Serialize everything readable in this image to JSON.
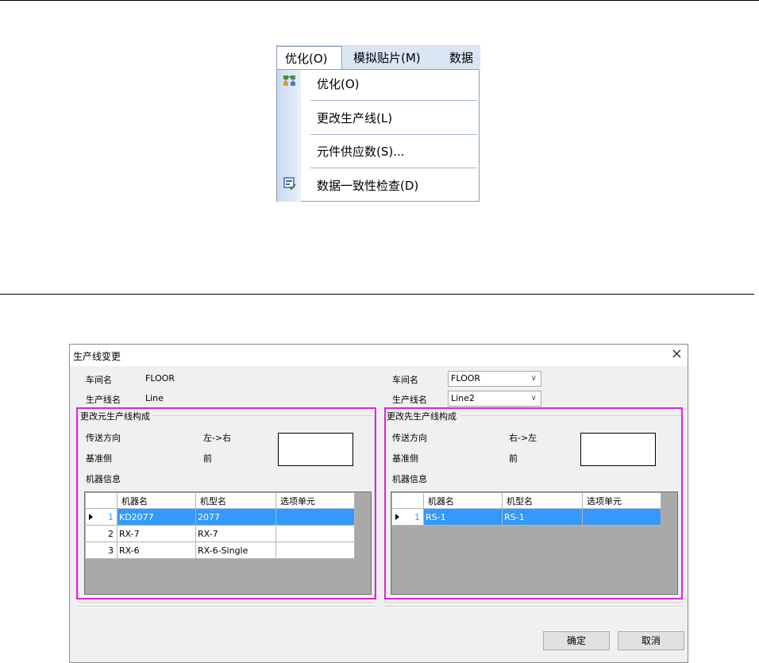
{
  "menu": {
    "bar": [
      "优化(O)",
      "模拟贴片(M)",
      "数据"
    ],
    "items": [
      {
        "label": "优化(O)",
        "icon": "optimize-icon"
      },
      {
        "label": "更改生产线(L)",
        "icon": ""
      },
      {
        "label": "元件供应数(S)...",
        "icon": ""
      },
      {
        "label": "数据一致性检查(D)",
        "icon": "data-check-icon"
      }
    ]
  },
  "dialog": {
    "title": "生产线变更",
    "close": "×",
    "left": {
      "workshop_label": "车间名",
      "workshop_value": "FLOOR",
      "line_label": "生产线名",
      "line_value": "Line",
      "group_title": "更改元生产线构成",
      "direction_label": "传送方向",
      "direction_value": "左->右",
      "reference_label": "基准侧",
      "reference_value": "前",
      "machine_info_label": "机器信息",
      "columns": [
        "机器名",
        "机型名",
        "选项单元"
      ],
      "rows": [
        {
          "no": "1",
          "machine": "KD2077",
          "model": "2077",
          "option": "",
          "selected": true
        },
        {
          "no": "2",
          "machine": "RX-7",
          "model": "RX-7",
          "option": "",
          "selected": false
        },
        {
          "no": "3",
          "machine": "RX-6",
          "model": "RX-6-Single",
          "option": "",
          "selected": false
        }
      ]
    },
    "right": {
      "workshop_label": "车间名",
      "workshop_value": "FLOOR",
      "line_label": "生产线名",
      "line_value": "Line2",
      "group_title": "更改先生产线构成",
      "direction_label": "传送方向",
      "direction_value": "右->左",
      "reference_label": "基准侧",
      "reference_value": "前",
      "machine_info_label": "机器信息",
      "columns": [
        "机器名",
        "机型名",
        "选项单元"
      ],
      "rows": [
        {
          "no": "1",
          "machine": "RS-1",
          "model": "RS-1",
          "option": "",
          "selected": true
        }
      ]
    },
    "ok_label": "确定",
    "cancel_label": "取消"
  },
  "colors": {
    "highlight": "#e51ee5",
    "selection": "#3399ff",
    "menubar": "#dbe6f4"
  }
}
